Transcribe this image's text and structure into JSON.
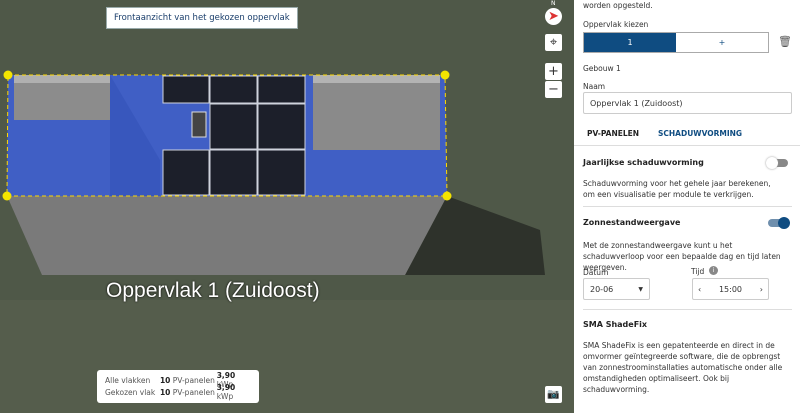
{
  "map": {
    "tooltip": "Frontaanzicht van het gekozen oppervlak",
    "surface_label": "Oppervlak 1 (Zuidoost)",
    "compass_label": "N",
    "summary": [
      {
        "label": "Alle vlakken",
        "count": "10",
        "unit": "PV-panelen",
        "power": "3,90",
        "power_unit": "kWp"
      },
      {
        "label": "Gekozen vlak",
        "count": "10",
        "unit": "PV-panelen",
        "power": "3,90",
        "power_unit": "kWp"
      }
    ]
  },
  "panel": {
    "intro_tail": "worden opgesteld.",
    "choose_label": "Oppervlak kiezen",
    "segments": [
      "1",
      "+"
    ],
    "building": "Gebouw 1",
    "name_label": "Naam",
    "name_value": "Oppervlak 1 (Zuidoost)",
    "tabs": [
      "PV-PANELEN",
      "SCHADUWVORMING"
    ],
    "annual": {
      "title": "Jaarlijkse schaduwvorming",
      "on": false,
      "desc": "Schaduwvorming voor het gehele jaar berekenen, om een visualisatie per module te verkrijgen."
    },
    "sun": {
      "title": "Zonnestandweergave",
      "on": true,
      "desc": "Met de zonnestandweergave kunt u het schaduwverloop voor een bepaalde dag en tijd laten weergeven."
    },
    "date_label": "Datum",
    "date_value": "20-06",
    "time_label": "Tijd",
    "time_value": "15:00",
    "shadefix": {
      "title": "SMA ShadeFix",
      "desc": "SMA ShadeFix is een gepatenteerde en direct in de omvormer geïntegreerde software, die de opbrengst van zonnestroominstallaties automatische onder alle omstandigheden optimaliseert. Ook bij schaduwvorming."
    },
    "accent": "#0f4c81"
  }
}
